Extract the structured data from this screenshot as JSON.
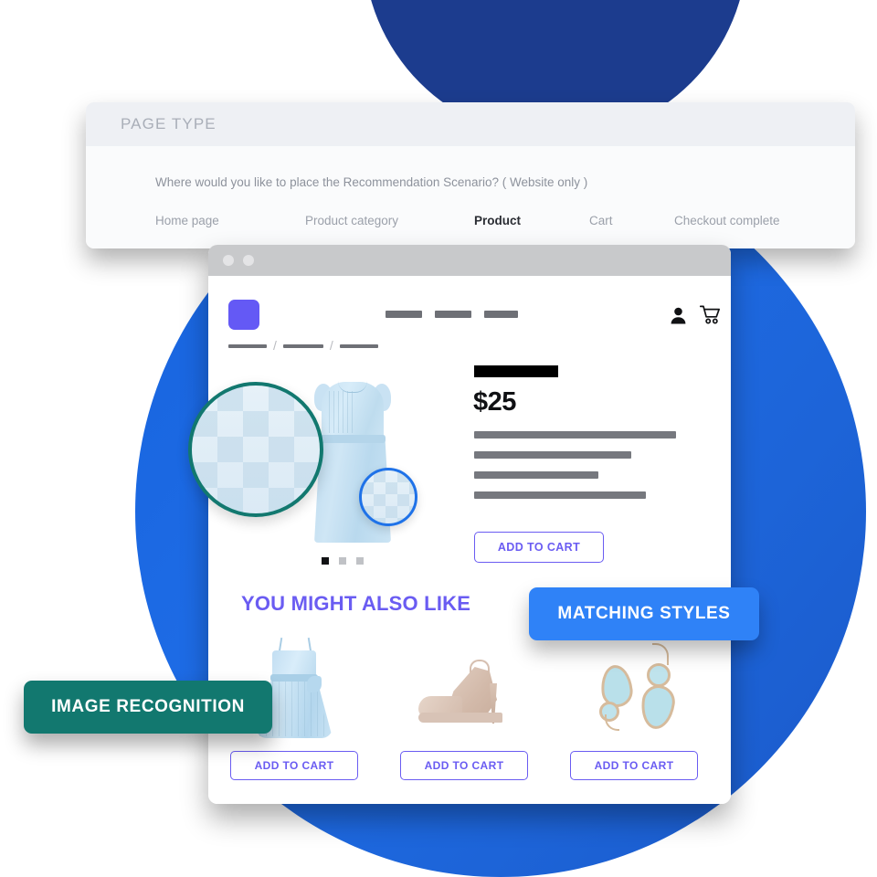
{
  "panel": {
    "title": "PAGE TYPE",
    "question": "Where would you like to place the Recommendation Scenario? ( Website only )",
    "tabs": [
      {
        "label": "Home page",
        "active": false
      },
      {
        "label": "Product category",
        "active": false
      },
      {
        "label": "Product",
        "active": true
      },
      {
        "label": "Cart",
        "active": false
      },
      {
        "label": "Checkout complete",
        "active": false
      }
    ]
  },
  "browser": {
    "chrome_dots": 2,
    "site_header": {
      "logo_icon": "purple-square-logo",
      "nav_placeholders": 3,
      "user_icon": "user-icon",
      "cart_icon": "shopping-cart-icon"
    },
    "breadcrumb": {
      "separator": "/",
      "placeholders": 3
    },
    "product": {
      "title_placeholder": "product-title-bar",
      "price": "$25",
      "description_placeholder_lines": 4,
      "add_to_cart_label": "ADD TO CART",
      "carousel_dots": 3,
      "carousel_active_index": 0,
      "image_alt": "light blue sleeveless dress",
      "magnifier_large_icon": "magnifier-circle-teal",
      "magnifier_small_icon": "magnifier-circle-blue"
    },
    "recommendations": {
      "title": "YOU MIGHT ALSO LIKE",
      "items": [
        {
          "name": "blue-sundress",
          "add_to_cart_label": "ADD TO CART"
        },
        {
          "name": "nude-high-heel",
          "add_to_cart_label": "ADD TO CART"
        },
        {
          "name": "blue-teardrop-earrings",
          "add_to_cart_label": "ADD TO CART"
        }
      ]
    }
  },
  "badges": [
    {
      "label": "IMAGE RECOGNITION",
      "color": "#12786f"
    },
    {
      "label": "MATCHING STYLES",
      "color": "#2f82f7"
    }
  ],
  "colors": {
    "navy_circle": "#1c3c8e",
    "blue_circle": "#1e6ce6",
    "accent_purple": "#6a5cf2",
    "teal": "#12786f",
    "badge_blue": "#2f82f7"
  }
}
